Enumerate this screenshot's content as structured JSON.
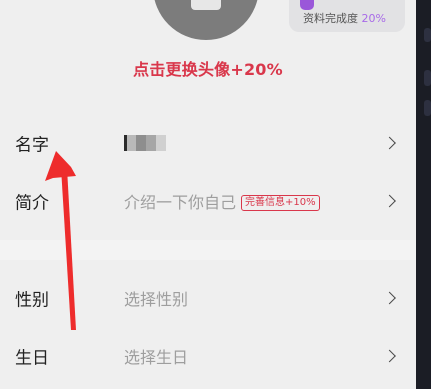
{
  "profile": {
    "completion_label": "资料完成度",
    "completion_percent": "20%",
    "change_avatar_label": "点击更换头像+20%"
  },
  "rows": {
    "name": {
      "label": "名字"
    },
    "bio": {
      "label": "简介",
      "placeholder": "介绍一下你自己",
      "tag": "完善信息+10%"
    },
    "gender": {
      "label": "性别",
      "placeholder": "选择性别"
    },
    "birthday": {
      "label": "生日",
      "placeholder": "选择生日"
    }
  },
  "colors": {
    "accent_red": "#d9374b",
    "purple": "#a86ae8",
    "annotation_arrow": "#ee2c2c"
  }
}
